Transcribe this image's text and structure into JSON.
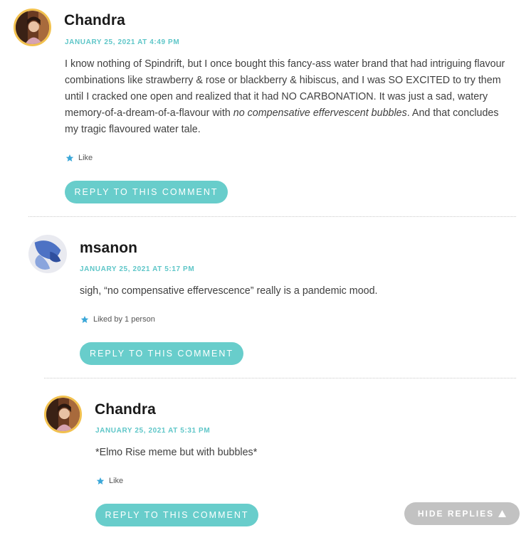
{
  "comments": [
    {
      "author": "Chandra",
      "date": "JANUARY 25, 2021 AT 4:49 PM",
      "body_before_italic": "I know nothing of Spindrift, but I once bought this fancy-ass water brand that had intriguing flavour combinations like strawberry & rose or blackberry & hibiscus, and I was SO EXCITED to try them until I cracked one open and realized that it had NO CARBONATION. It was just a sad, watery memory-of-a-dream-of-a-flavour with ",
      "body_italic": "no compensative effervescent bubbles",
      "body_after_italic": ". And that concludes my tragic flavoured water tale.",
      "like_label": "Like",
      "reply_label": "REPLY TO THIS COMMENT",
      "avatar_icon": "avatar-photo-icon"
    },
    {
      "author": "msanon",
      "date": "JANUARY 25, 2021 AT 5:17 PM",
      "body": "sigh, “no compensative effervescence” really is a pandemic mood.",
      "like_label": "Liked by 1 person",
      "reply_label": "REPLY TO THIS COMMENT",
      "avatar_icon": "avatar-blue-petal-icon"
    },
    {
      "author": "Chandra",
      "date": "JANUARY 25, 2021 AT 5:31 PM",
      "body": "*Elmo Rise meme but with bubbles*",
      "like_label": "Like",
      "reply_label": "REPLY TO THIS COMMENT",
      "avatar_icon": "avatar-photo-icon"
    }
  ],
  "hide_replies_label": "HIDE REPLIES",
  "colors": {
    "accent": "#68cdcb",
    "date": "#5ec6c8",
    "avatar_border": "#f2c14e",
    "star": "#3aa7d8",
    "hide_button": "#c2c2c2"
  }
}
